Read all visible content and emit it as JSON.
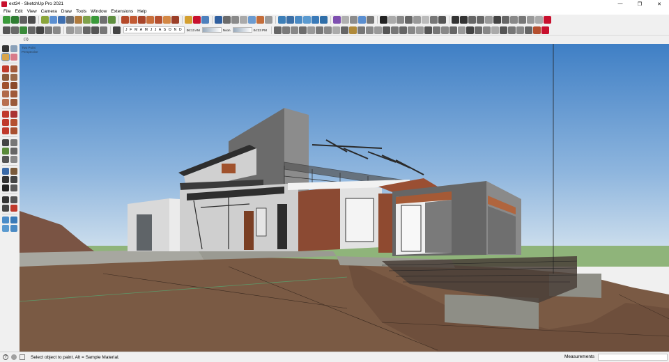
{
  "window": {
    "title": "ext34 - SketchUp Pro 2021",
    "minimize_glyph": "—",
    "maximize_glyph": "❐",
    "close_glyph": "✕"
  },
  "menu": [
    "File",
    "Edit",
    "View",
    "Camera",
    "Draw",
    "Tools",
    "Window",
    "Extensions",
    "Help"
  ],
  "shadows": {
    "months": "J F M A M J J A S O N D",
    "time_start": "06:13 AM",
    "time_mid": "Noon",
    "time_end": "04:23 PM"
  },
  "scene_tab": "(1)",
  "viewport": {
    "camera_line1": "Two Point",
    "camera_line2": "Perspective"
  },
  "status": {
    "hint": "Select object to paint. Alt = Sample Material.",
    "measurements_label": "Measurements",
    "measurements_value": ""
  },
  "colors": {
    "sky_top": "#3f7fc5",
    "sky_bottom": "#d6e4ef",
    "ground": "#7a5a44",
    "horizon_green": "#8fb47a",
    "accent_red": "#c8102e"
  }
}
